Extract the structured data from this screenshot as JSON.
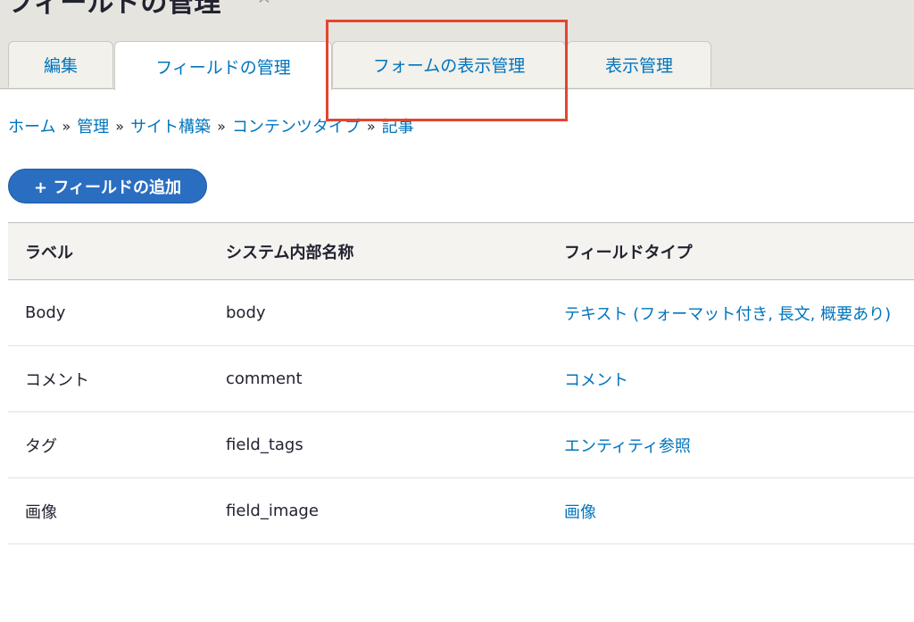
{
  "header": {
    "title": "フィールドの管理",
    "star_icon": "☆"
  },
  "tabs": [
    {
      "label": "編集",
      "active": false
    },
    {
      "label": "フィールドの管理",
      "active": true
    },
    {
      "label": "フォームの表示管理",
      "active": false
    },
    {
      "label": "表示管理",
      "active": false
    }
  ],
  "breadcrumb": {
    "items": [
      "ホーム",
      "管理",
      "サイト構築",
      "コンテンツタイプ",
      "記事"
    ],
    "separator": "»"
  },
  "add_button": {
    "label": "+ フィールドの追加"
  },
  "table": {
    "columns": [
      "ラベル",
      "システム内部名称",
      "フィールドタイプ"
    ],
    "rows": [
      {
        "label": "Body",
        "machine_name": "body",
        "type": "テキスト (フォーマット付き, 長文, 概要あり)"
      },
      {
        "label": "コメント",
        "machine_name": "comment",
        "type": "コメント"
      },
      {
        "label": "タグ",
        "machine_name": "field_tags",
        "type": "エンティティ参照"
      },
      {
        "label": "画像",
        "machine_name": "field_image",
        "type": "画像"
      }
    ]
  },
  "colors": {
    "link": "#0074bd",
    "button": "#2a6ec1",
    "highlight": "#e2462f",
    "header_bg": "#e6e4df"
  }
}
